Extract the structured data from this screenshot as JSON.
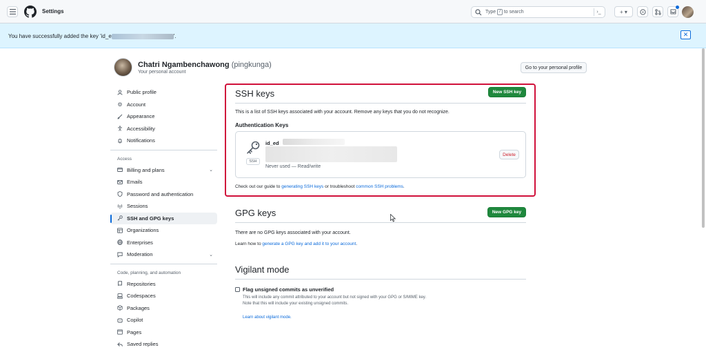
{
  "header": {
    "title": "Settings",
    "search_text": "Type",
    "search_key": "/",
    "search_suffix": "to search",
    "command_glyph": "›_",
    "plus_glyph": "+ ▾"
  },
  "flash": {
    "message_prefix": "You have successfully added the key 'id_e",
    "message_suffix": "'.",
    "close_glyph": "✕"
  },
  "user": {
    "name": "Chatri Ngambenchawong",
    "handle": "(pingkunga)",
    "subtitle": "Your personal account",
    "profile_button": "Go to your personal profile"
  },
  "sidebar": {
    "items_top": [
      {
        "label": "Public profile",
        "icon": "person-icon"
      },
      {
        "label": "Account",
        "icon": "gear-icon"
      },
      {
        "label": "Appearance",
        "icon": "paintbrush-icon"
      },
      {
        "label": "Accessibility",
        "icon": "accessibility-icon"
      },
      {
        "label": "Notifications",
        "icon": "bell-icon"
      }
    ],
    "access_heading": "Access",
    "items_access": [
      {
        "label": "Billing and plans",
        "icon": "credit-card-icon"
      },
      {
        "label": "Emails",
        "icon": "mail-icon"
      },
      {
        "label": "Password and authentication",
        "icon": "shield-lock-icon"
      },
      {
        "label": "Sessions",
        "icon": "broadcast-icon"
      },
      {
        "label": "SSH and GPG keys",
        "icon": "key-icon"
      },
      {
        "label": "Organizations",
        "icon": "table-icon"
      },
      {
        "label": "Enterprises",
        "icon": "globe-icon"
      },
      {
        "label": "Moderation",
        "icon": "report-icon"
      }
    ],
    "code_heading": "Code, planning, and automation",
    "items_code": [
      {
        "label": "Repositories",
        "icon": "repo-icon"
      },
      {
        "label": "Codespaces",
        "icon": "codespaces-icon"
      },
      {
        "label": "Packages",
        "icon": "package-icon"
      },
      {
        "label": "Copilot",
        "icon": "copilot-icon"
      },
      {
        "label": "Pages",
        "icon": "browser-icon"
      },
      {
        "label": "Saved replies",
        "icon": "reply-icon"
      }
    ]
  },
  "ssh": {
    "title": "SSH keys",
    "new_button": "New SSH key",
    "description": "This is a list of SSH keys associated with your account. Remove any keys that you do not recognize.",
    "auth_heading": "Authentication Keys",
    "key_name": "id_ed",
    "key_badge": "SSH",
    "key_usage": "Never used — Read/write",
    "delete_button": "Delete",
    "footer_prefix": "Check out our guide to",
    "footer_link1": "generating SSH keys",
    "footer_middle": "or troubleshoot",
    "footer_link2": "common SSH problems",
    "footer_suffix": "."
  },
  "gpg": {
    "title": "GPG keys",
    "new_button": "New GPG key",
    "empty_text": "There are no GPG keys associated with your account.",
    "learn_prefix": "Learn how to",
    "learn_link": "generate a GPG key and add it to your account",
    "learn_suffix": "."
  },
  "vigilant": {
    "title": "Vigilant mode",
    "checkbox_label": "Flag unsigned commits as unverified",
    "desc_line1": "This will include any commit attributed to your account but not signed with your GPG or S/MIME key.",
    "desc_line2": "Note that this will include your existing unsigned commits.",
    "learn_link": "Learn about vigilant mode."
  },
  "colors": {
    "accent": "#0969da",
    "primary_button": "#1f883d",
    "highlight_border": "#d0103a",
    "danger": "#cf222e",
    "flash_bg": "#ddf4ff"
  }
}
